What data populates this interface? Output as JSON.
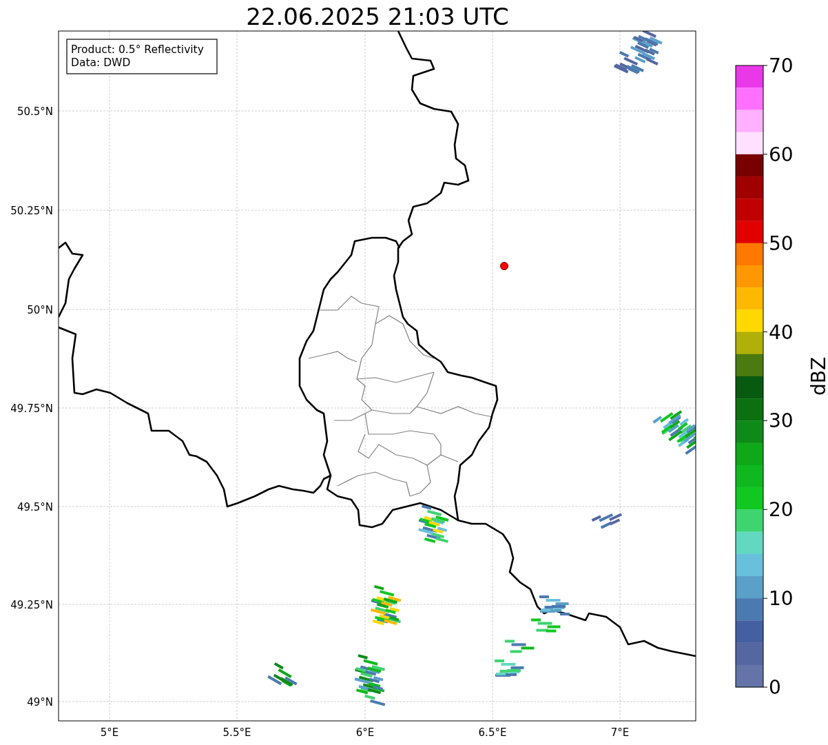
{
  "title": "22.06.2025 21:03 UTC",
  "legend": [
    "Product: 0.5° Reflectivity",
    "Data: DWD"
  ],
  "map": {
    "lat_ticks": [
      "50.5°N",
      "50.25°N",
      "50°N",
      "49.75°N",
      "49.5°N",
      "49.25°N",
      "49°N"
    ],
    "lon_ticks": [
      "5°E",
      "5.5°E",
      "6°E",
      "6.5°E",
      "7°E"
    ]
  },
  "colorbar": {
    "label": "dBZ",
    "ticks": [
      "70",
      "60",
      "50",
      "40",
      "30",
      "20",
      "10",
      "0"
    ],
    "segments": [
      {
        "color": "#e838e8"
      },
      {
        "color": "#ff70ff"
      },
      {
        "color": "#ffb0ff"
      },
      {
        "color": "#ffe0ff"
      },
      {
        "color": "#780000"
      },
      {
        "color": "#a00000"
      },
      {
        "color": "#c00000"
      },
      {
        "color": "#e00000"
      },
      {
        "color": "#ff7800"
      },
      {
        "color": "#ff9800"
      },
      {
        "color": "#ffb800"
      },
      {
        "color": "#ffd800"
      },
      {
        "color": "#b0b008"
      },
      {
        "color": "#4a7a10"
      },
      {
        "color": "#085a10"
      },
      {
        "color": "#0a7010"
      },
      {
        "color": "#0e8a18"
      },
      {
        "color": "#0fa818"
      },
      {
        "color": "#10b820"
      },
      {
        "color": "#10c820"
      },
      {
        "color": "#3ed470"
      },
      {
        "color": "#62d8c0"
      },
      {
        "color": "#68c0dc"
      },
      {
        "color": "#5aa0c8"
      },
      {
        "color": "#4a7ab0"
      },
      {
        "color": "#4560a0"
      },
      {
        "color": "#5567a0"
      },
      {
        "color": "#6474a8"
      }
    ]
  }
}
